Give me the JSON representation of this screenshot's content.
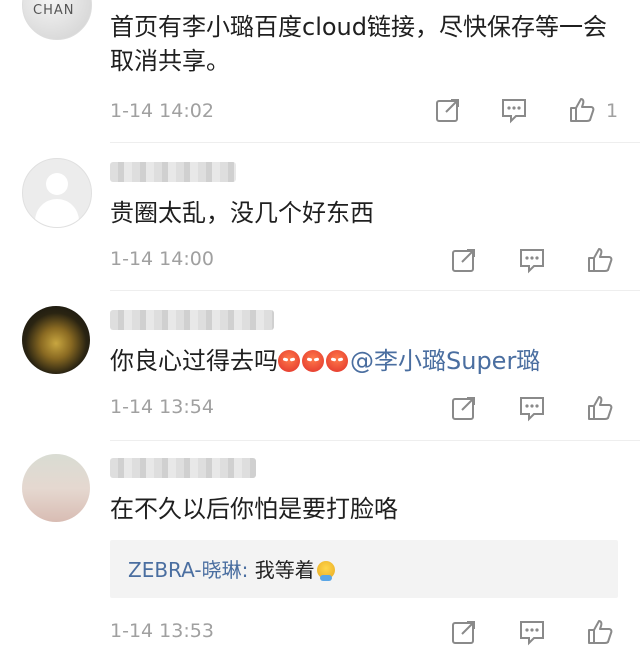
{
  "comments": [
    {
      "text": "首页有李小璐百度cloud链接，尽快保存等一会取消共享。",
      "time": "1-14 14:02",
      "like_count": "1"
    },
    {
      "text": "贵圈太乱，没几个好东西",
      "time": "1-14 14:00"
    },
    {
      "text": "你良心过得去吗",
      "mention": "@李小璐Super璐",
      "time": "1-14 13:54"
    },
    {
      "text": "在不久以后你怕是要打脸咯",
      "reply": {
        "name": "ZEBRA-晓琳:",
        "text": " 我等着"
      },
      "time": "1-14 13:53"
    }
  ],
  "avatar1_brand": "CHAN",
  "icons": [
    "share-icon",
    "comment-icon",
    "like-icon"
  ],
  "colors": {
    "link": "#4a6ea0",
    "meta": "#a0a0a0",
    "reply_bg": "#f3f3f3"
  }
}
